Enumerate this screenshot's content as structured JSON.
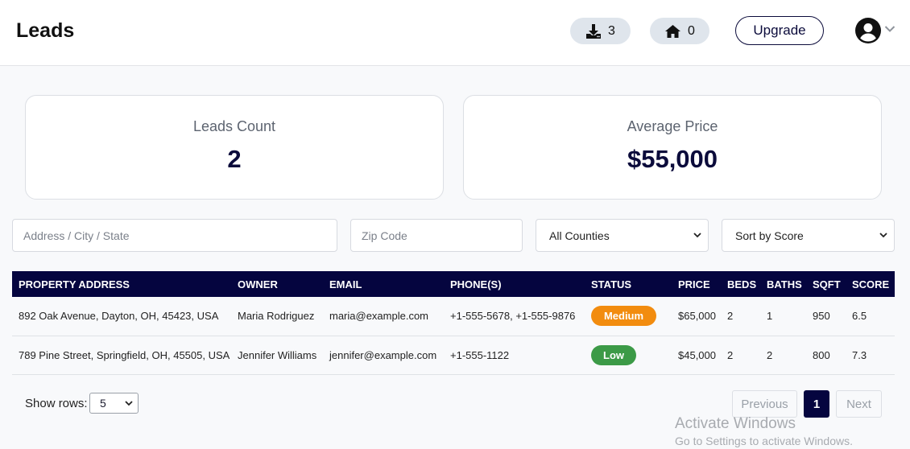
{
  "header": {
    "title": "Leads",
    "downloads_count": "3",
    "homes_count": "0",
    "upgrade_label": "Upgrade",
    "download_icon": "download-icon",
    "home_icon": "home-icon",
    "avatar_icon": "user-circle-icon"
  },
  "stats": {
    "leads_count_label": "Leads Count",
    "leads_count_value": "2",
    "avg_price_label": "Average Price",
    "avg_price_value": "$55,000"
  },
  "filters": {
    "address_placeholder": "Address / City / State",
    "zip_placeholder": "Zip Code",
    "county_selected": "All Counties",
    "sort_selected": "Sort by Score"
  },
  "table": {
    "columns": [
      "PROPERTY ADDRESS",
      "OWNER",
      "EMAIL",
      "PHONE(S)",
      "STATUS",
      "PRICE",
      "BEDS",
      "BATHS",
      "SQFT",
      "SCORE"
    ],
    "rows": [
      {
        "address": "892 Oak Avenue, Dayton, OH, 45423, USA",
        "owner": "Maria Rodriguez",
        "email": "maria@example.com",
        "phones": "+1-555-5678, +1-555-9876",
        "status": "Medium",
        "price": "$65,000",
        "beds": "2",
        "baths": "1",
        "sqft": "950",
        "score": "6.5"
      },
      {
        "address": "789 Pine Street, Springfield, OH, 45505, USA",
        "owner": "Jennifer Williams",
        "email": "jennifer@example.com",
        "phones": "+1-555-1122",
        "status": "Low",
        "price": "$45,000",
        "beds": "2",
        "baths": "2",
        "sqft": "800",
        "score": "7.3"
      }
    ]
  },
  "pagination": {
    "show_rows_label": "Show rows:",
    "rows_per_page": "5",
    "previous_label": "Previous",
    "current_page": "1",
    "next_label": "Next"
  },
  "watermark": {
    "title": "Activate Windows",
    "subtitle": "Go to Settings to activate Windows."
  },
  "colors": {
    "navy": "#05053f",
    "status_medium": "#f28c0f",
    "status_low": "#3c9a47"
  }
}
